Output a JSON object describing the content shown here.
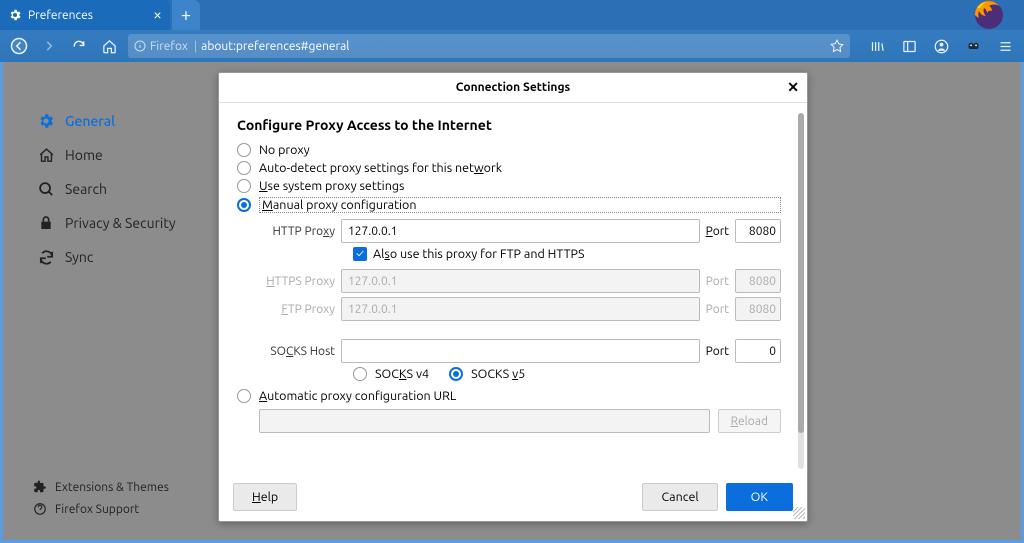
{
  "tab": {
    "title": "Preferences"
  },
  "urlbar": {
    "prefix": "Firefox",
    "url": "about:preferences#general"
  },
  "sidebar": {
    "items": [
      {
        "label": "General"
      },
      {
        "label": "Home"
      },
      {
        "label": "Search"
      },
      {
        "label": "Privacy & Security"
      },
      {
        "label": "Sync"
      }
    ]
  },
  "footer": {
    "items": [
      {
        "label": "Extensions & Themes"
      },
      {
        "label": "Firefox Support"
      }
    ]
  },
  "modal": {
    "title": "Connection Settings",
    "section_title": "Configure Proxy Access to the Internet",
    "radios": {
      "no_proxy": "No proxy",
      "auto_detect_pre": "Auto-detect proxy settings for this net",
      "auto_detect_u": "w",
      "auto_detect_post": "ork",
      "system_u": "U",
      "system_post": "se system proxy settings",
      "manual_u": "M",
      "manual_post": "anual proxy configuration",
      "pac_u": "A",
      "pac_post": "utomatic proxy configuration URL"
    },
    "fields": {
      "http_label_pre": "HTTP Pro",
      "http_label_u": "x",
      "http_label_post": "y",
      "http_value": "127.0.0.1",
      "http_port": "8080",
      "also_use_pre": "Al",
      "also_use_u": "s",
      "also_use_post": "o use this proxy for FTP and HTTPS",
      "https_label_u": "H",
      "https_label_post": "TTPS Proxy",
      "https_value": "127.0.0.1",
      "https_port": "8080",
      "ftp_label_u": "F",
      "ftp_label_post": "TP Proxy",
      "ftp_value": "127.0.0.1",
      "ftp_port": "8080",
      "socks_label_pre": "SO",
      "socks_label_u": "C",
      "socks_label_post": "KS Host",
      "socks_value": "",
      "socks_port": "0",
      "socks_v4_pre": "SOC",
      "socks_v4_u": "K",
      "socks_v4_post": "S v4",
      "socks_v5_pre": "SOCKS ",
      "socks_v5_u": "v",
      "socks_v5_post": "5",
      "port_label_u": "P",
      "port_label_post": "ort",
      "port_label_plain": "Port",
      "reload": "Reload",
      "reload_u": "R",
      "reload_post": "eload"
    },
    "buttons": {
      "help": "Help",
      "cancel": "Cancel",
      "ok": "OK"
    }
  }
}
